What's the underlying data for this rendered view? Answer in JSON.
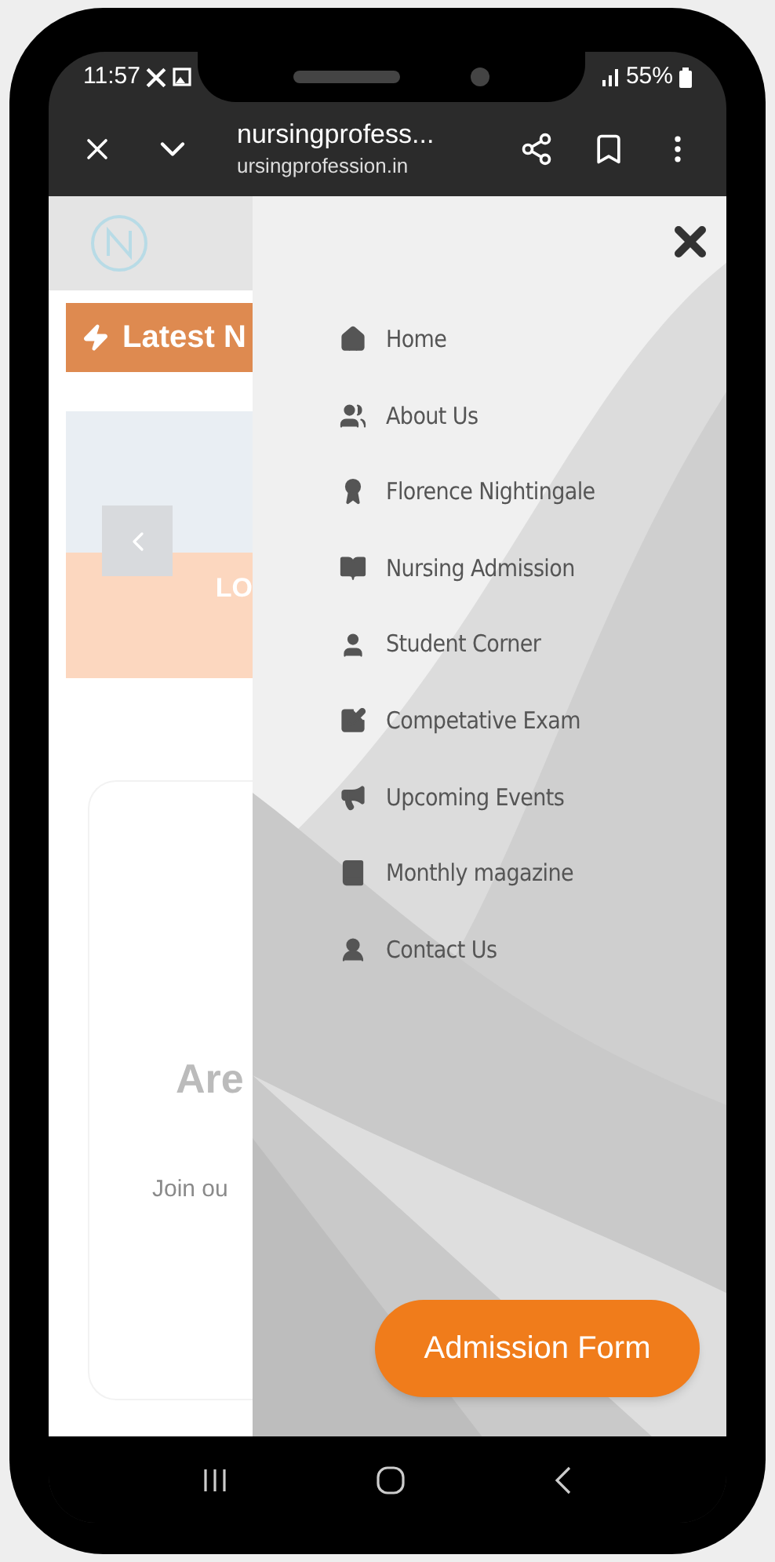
{
  "status_bar": {
    "time": "11:57",
    "battery": "55%"
  },
  "browser": {
    "title": "nursingprofess...",
    "url": "ursingprofession.in"
  },
  "background_page": {
    "banner": "Latest N",
    "slide_caption": "LO",
    "card_heading": "Are",
    "card_text": "Join ou"
  },
  "menu": {
    "items": [
      {
        "label": "Home",
        "kind": "home"
      },
      {
        "label": "About Us",
        "kind": "group"
      },
      {
        "label": "Florence Nightingale",
        "kind": "award"
      },
      {
        "label": "Nursing Admission",
        "kind": "book"
      },
      {
        "label": "Student Corner",
        "kind": "user"
      },
      {
        "label": "Competative Exam",
        "kind": "edit"
      },
      {
        "label": "Upcoming Events",
        "kind": "megaphone"
      },
      {
        "label": "Monthly magazine",
        "kind": "magazine"
      },
      {
        "label": "Contact Us",
        "kind": "contact"
      }
    ]
  },
  "admission_button": "Admission Form"
}
